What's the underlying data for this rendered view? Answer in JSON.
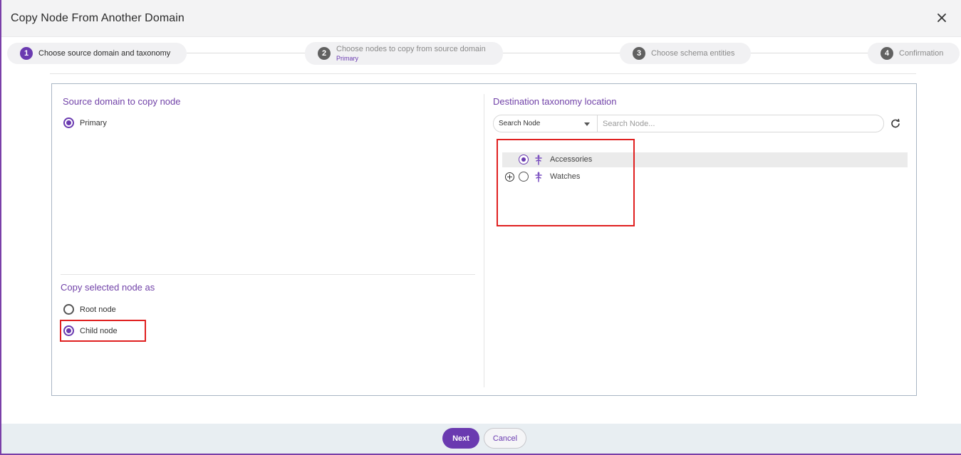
{
  "dialog": {
    "title": "Copy Node From Another Domain",
    "close_icon": "close-icon"
  },
  "stepper": {
    "steps": [
      {
        "number": "1",
        "label": "Choose source domain and taxonomy",
        "sub": "",
        "active": true
      },
      {
        "number": "2",
        "label": "Choose nodes to copy from source domain",
        "sub": "Primary",
        "active": false
      },
      {
        "number": "3",
        "label": "Choose schema entities",
        "sub": "",
        "active": false
      },
      {
        "number": "4",
        "label": "Confirmation",
        "sub": "",
        "active": false
      }
    ]
  },
  "source": {
    "title": "Source domain to copy node",
    "options": [
      {
        "label": "Primary",
        "checked": true
      }
    ]
  },
  "copy_as": {
    "title": "Copy selected node as",
    "options": [
      {
        "label": "Root node",
        "checked": false
      },
      {
        "label": "Child node",
        "checked": true
      }
    ]
  },
  "destination": {
    "title": "Destination taxonomy location",
    "search_type": "Search Node",
    "search_placeholder": "Search Node...",
    "refresh_icon": "refresh-icon",
    "tree": [
      {
        "label": "Accessories",
        "checked": true,
        "expandable": false,
        "icon": "taxonomy-node-icon"
      },
      {
        "label": "Watches",
        "checked": false,
        "expandable": true,
        "icon": "taxonomy-node-icon"
      }
    ]
  },
  "footer": {
    "next_label": "Next",
    "cancel_label": "Cancel"
  },
  "colors": {
    "accent": "#6a3ab0",
    "section_title": "#7142a8",
    "highlight_box": "#e02020"
  }
}
